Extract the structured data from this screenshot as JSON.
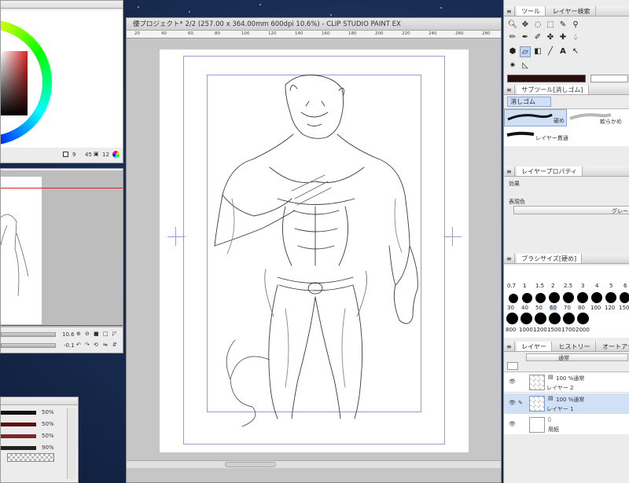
{
  "document": {
    "title": "優プロジェクト* 2/2 (257.00 x 364.00mm 600dpi 10.6%) - CLIP STUDIO PAINT EX",
    "ruler_ticks": [
      "20",
      "40",
      "60",
      "80",
      "100",
      "120",
      "140",
      "160",
      "180",
      "200",
      "220",
      "240",
      "260",
      "280"
    ]
  },
  "color_panel": {
    "readout": [
      "9",
      "45",
      "12"
    ]
  },
  "navigator": {
    "zoom": "10.6",
    "rotate": "-0.1"
  },
  "tool_panel": {
    "tabs": [
      "ツール",
      "レイヤー検索"
    ],
    "tools": [
      "zoom-icon",
      "move-icon",
      "lasso-icon",
      "select-icon",
      "eyedropper-icon",
      "pen-icon",
      "pencil-icon",
      "brush-icon",
      "airbrush-icon",
      "deco-icon",
      "eraser-icon",
      "blend-icon",
      "fill-icon",
      "gradient-icon",
      "figure-icon",
      "text-icon",
      "frame-icon",
      "ruler-icon",
      "operation-icon",
      "balloon-icon"
    ]
  },
  "subtool_panel": {
    "header": "サブツール[消しゴム]",
    "group_tab": "消しゴム",
    "items": [
      {
        "label": "硬め"
      },
      {
        "label": "軟らかめ"
      },
      {
        "label": "レイヤー貫通"
      }
    ]
  },
  "layer_property": {
    "header": "レイヤープロパティ",
    "effect_label": "効果",
    "expression_label": "表現色",
    "expression_value": "グレー"
  },
  "brush_size": {
    "header": "ブラシサイズ[硬め]",
    "row1": [
      "0.7",
      "1",
      "1.5",
      "2",
      "2.5",
      "3",
      "4",
      "5",
      "6"
    ],
    "row2": [
      "30",
      "40",
      "50",
      "60",
      "70",
      "80",
      "100",
      "120",
      "150"
    ],
    "row3": [
      "800",
      "1000",
      "1200",
      "1500",
      "1700",
      "2000"
    ]
  },
  "layers": {
    "tabs": [
      "レイヤー",
      "ヒストリー",
      "オートアクション"
    ],
    "blend_mode": "通常",
    "items": [
      {
        "opacity": "100 %通常",
        "name": "レイヤー 2",
        "selected": false
      },
      {
        "opacity": "100 %通常",
        "name": "レイヤー 1",
        "selected": true
      },
      {
        "opacity": "",
        "name": "用紙",
        "selected": false
      }
    ]
  },
  "color_set": {
    "percents": [
      "50%",
      "50%",
      "50%",
      "90%"
    ]
  },
  "colors": {
    "accent": "#4b86d6",
    "selection": "#cfe0f7"
  }
}
